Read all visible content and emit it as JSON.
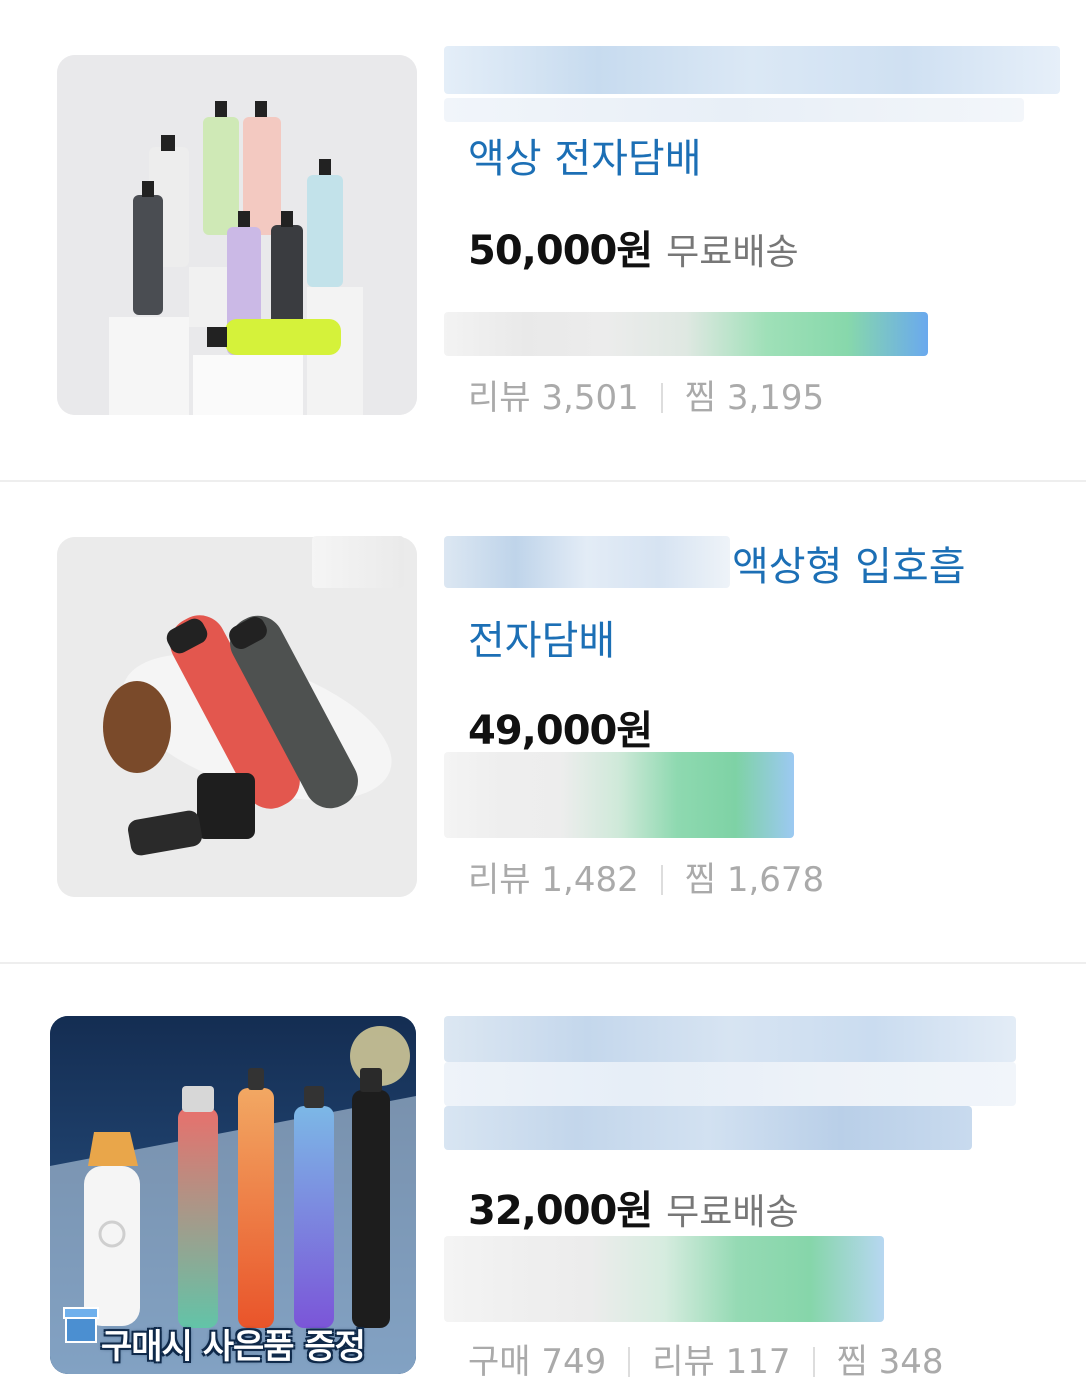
{
  "products": [
    {
      "title": "액상 전자담배",
      "price": "50,000원",
      "shipping": "무료배송",
      "review_label": "리뷰",
      "review_count": "3,501",
      "wish_label": "찜",
      "wish_count": "3,195",
      "thumb_icon": "pod-vape-collection-image"
    },
    {
      "title_line1": "액상형 입호흡",
      "title_line2": "전자담배",
      "price": "49,000원",
      "review_label": "리뷰",
      "review_count": "1,482",
      "wish_label": "찜",
      "wish_count": "1,678",
      "thumb_icon": "pod-device-image"
    },
    {
      "price": "32,000원",
      "shipping": "무료배송",
      "purchase_label": "구매",
      "purchase_count": "749",
      "review_label": "리뷰",
      "review_count": "117",
      "wish_label": "찜",
      "wish_count": "348",
      "banner_text": "구매시 사은품 증정",
      "thumb_icon": "vape-pen-lineup-image"
    }
  ],
  "colors": {
    "title_blue": "#1c6fb5",
    "price_black": "#111111",
    "meta_gray": "#aaaaaa"
  }
}
